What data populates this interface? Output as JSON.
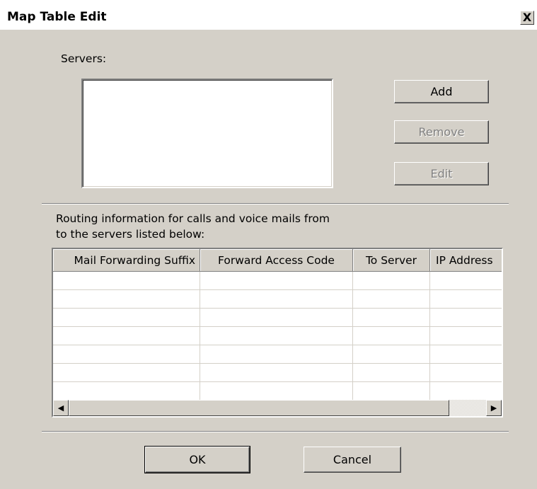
{
  "window": {
    "title": "Map Table Edit",
    "close_symbol": "X"
  },
  "servers": {
    "label": "Servers:",
    "items": [],
    "buttons": {
      "add": "Add",
      "remove": "Remove",
      "edit": "Edit"
    }
  },
  "routing": {
    "description_line1": "Routing information for calls and voice mails from",
    "description_line2": "to the servers listed below:",
    "columns": [
      "Mail Forwarding Suffix",
      "Forward Access Code",
      "To Server",
      "IP Address"
    ],
    "rows": []
  },
  "footer": {
    "ok": "OK",
    "cancel": "Cancel"
  },
  "icons": {
    "scroll_left": "scroll-left-arrow-icon",
    "scroll_right": "scroll-right-arrow-icon",
    "close": "close-icon"
  },
  "colors": {
    "dialog_bg": "#d4d0c8",
    "title_bg": "#ffffff",
    "disabled_text": "#808080"
  }
}
